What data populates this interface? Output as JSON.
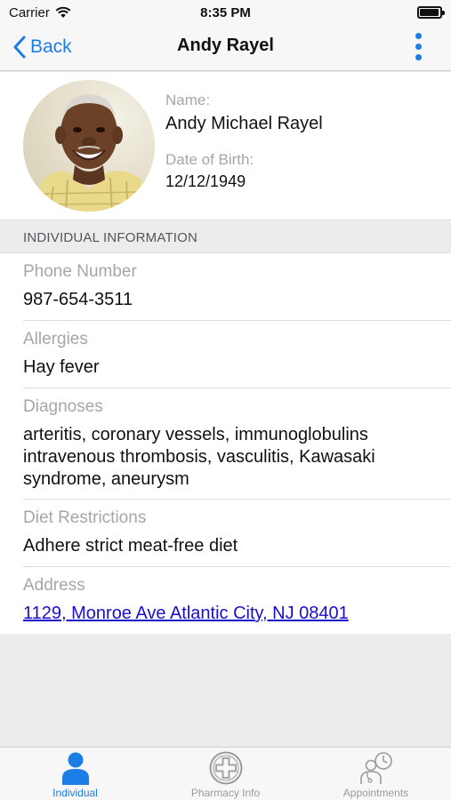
{
  "status_bar": {
    "carrier": "Carrier",
    "time": "8:35 PM"
  },
  "nav": {
    "back_label": "Back",
    "title": "Andy Rayel"
  },
  "profile": {
    "name_label": "Name:",
    "name": "Andy Michael Rayel",
    "dob_label": "Date of Birth:",
    "dob": "12/12/1949"
  },
  "section_header": "INDIVIDUAL INFORMATION",
  "info": {
    "phone_label": "Phone Number",
    "phone": "987-654-3511",
    "allergies_label": "Allergies",
    "allergies": "Hay fever",
    "diagnoses_label": "Diagnoses",
    "diagnoses_line1": "arteritis, coronary vessels, immunoglobulins",
    "diagnoses_line2": "intravenous thrombosis, vasculitis, Kawasaki",
    "diagnoses_line3": "syndrome, aneurysm",
    "diet_label": "Diet Restrictions",
    "diet": "Adhere strict meat-free diet",
    "address_label": "Address",
    "address": "1129, Monroe Ave Atlantic City, NJ 08401"
  },
  "tabs": [
    {
      "label": "Individual",
      "icon": "person-icon",
      "active": true
    },
    {
      "label": "Pharmacy Info",
      "icon": "medical-cross-icon",
      "active": false
    },
    {
      "label": "Appointments",
      "icon": "doctor-clock-icon",
      "active": false
    }
  ],
  "colors": {
    "accent": "#1a7ee6",
    "link": "#1a0dcc",
    "label_gray": "#a6a6aa"
  }
}
